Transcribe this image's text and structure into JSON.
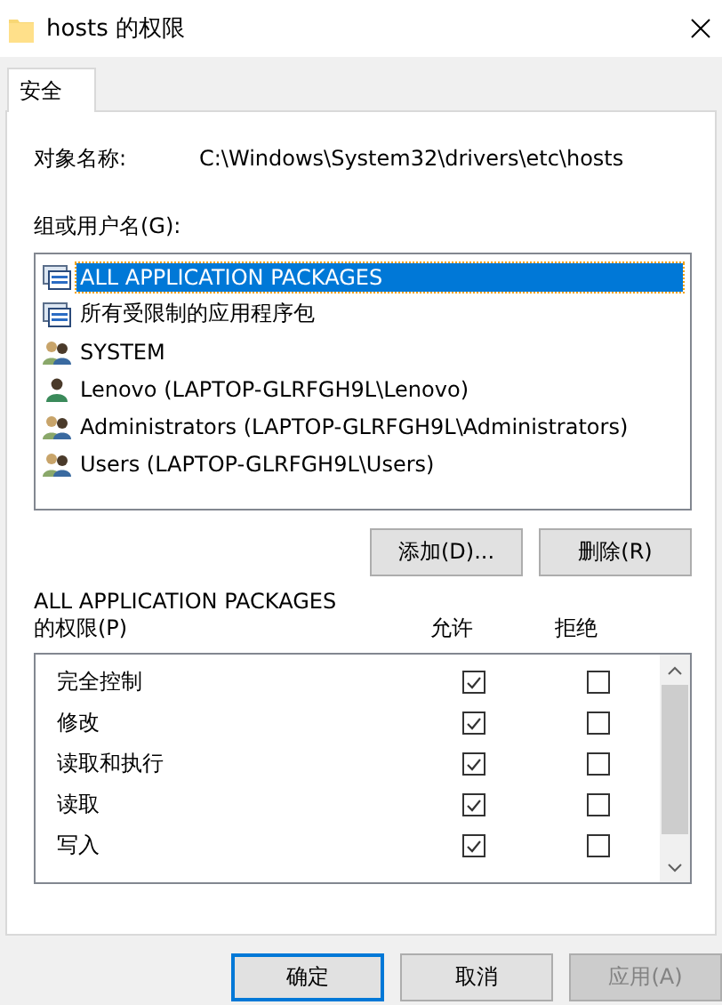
{
  "window": {
    "title": "hosts 的权限"
  },
  "tabs": [
    {
      "label": "安全",
      "selected": true
    }
  ],
  "object_name": {
    "label": "对象名称:",
    "value": "C:\\Windows\\System32\\drivers\\etc\\hosts"
  },
  "users": {
    "label": "组或用户名(G):",
    "items": [
      {
        "name": "ALL APPLICATION PACKAGES",
        "kind": "package",
        "selected": true
      },
      {
        "name": "所有受限制的应用程序包",
        "kind": "package",
        "selected": false
      },
      {
        "name": "SYSTEM",
        "kind": "group",
        "selected": false
      },
      {
        "name": "Lenovo (LAPTOP-GLRFGH9L\\Lenovo)",
        "kind": "user",
        "selected": false
      },
      {
        "name": "Administrators (LAPTOP-GLRFGH9L\\Administrators)",
        "kind": "group",
        "selected": false
      },
      {
        "name": "Users (LAPTOP-GLRFGH9L\\Users)",
        "kind": "group",
        "selected": false
      }
    ],
    "buttons": [
      "添加(D)...",
      "删除(R)"
    ]
  },
  "permissions": {
    "subject": "ALL APPLICATION PACKAGES",
    "label": "的权限(P)",
    "allow_header": "允许",
    "deny_header": "拒绝",
    "rows": [
      {
        "name": "完全控制",
        "allow": true,
        "deny": false
      },
      {
        "name": "修改",
        "allow": true,
        "deny": false
      },
      {
        "name": "读取和执行",
        "allow": true,
        "deny": false
      },
      {
        "name": "读取",
        "allow": true,
        "deny": false
      },
      {
        "name": "写入",
        "allow": true,
        "deny": false
      }
    ]
  },
  "footer": [
    {
      "label": "确定",
      "kind": "default",
      "disabled": false
    },
    {
      "label": "取消",
      "kind": "normal",
      "disabled": false
    },
    {
      "label": "应用(A)",
      "kind": "normal",
      "disabled": true
    }
  ]
}
